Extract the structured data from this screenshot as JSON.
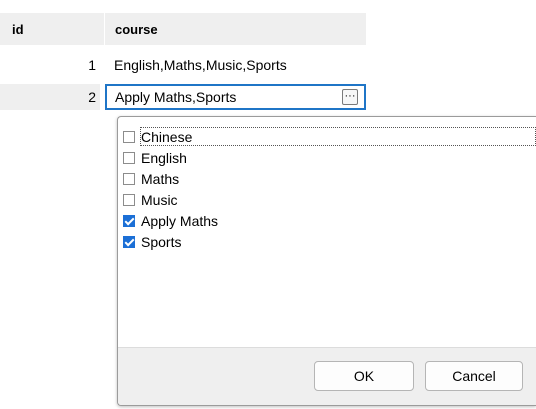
{
  "grid": {
    "headers": {
      "id": "id",
      "course": "course"
    },
    "rows": [
      {
        "id": "1",
        "course": "English,Maths,Music,Sports"
      },
      {
        "id": "2",
        "course": "Apply Maths,Sports"
      }
    ],
    "editor_button": "···"
  },
  "popup": {
    "options": [
      {
        "label": "Chinese",
        "checked": false
      },
      {
        "label": "English",
        "checked": false
      },
      {
        "label": "Maths",
        "checked": false
      },
      {
        "label": "Music",
        "checked": false
      },
      {
        "label": "Apply Maths",
        "checked": true
      },
      {
        "label": "Sports",
        "checked": true
      }
    ],
    "ok_label": "OK",
    "cancel_label": "Cancel"
  },
  "colors": {
    "accent": "#1b6fd6",
    "edit_border": "#1f75c7",
    "header_bg": "#efefef"
  }
}
